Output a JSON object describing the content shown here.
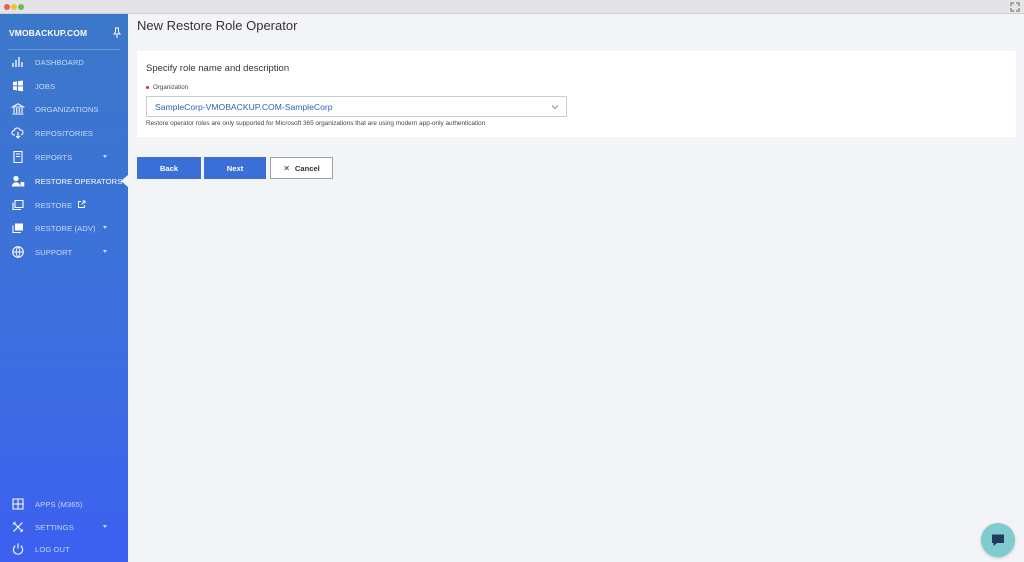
{
  "window": {
    "title": ""
  },
  "sidebar": {
    "brand": "VMOBACKUP.COM",
    "items": [
      {
        "label": "DASHBOARD",
        "icon": "dashboard-icon"
      },
      {
        "label": "JOBS",
        "icon": "windows-icon"
      },
      {
        "label": "ORGANIZATIONS",
        "icon": "bank-icon"
      },
      {
        "label": "REPOSITORIES",
        "icon": "cloud-download-icon"
      },
      {
        "label": "REPORTS",
        "icon": "report-icon",
        "has_caret": true
      },
      {
        "label": "RESTORE OPERATORS",
        "icon": "user-key-icon",
        "active": true
      },
      {
        "label": "RESTORE",
        "icon": "restore-icon",
        "external": true
      },
      {
        "label": "RESTORE (ADV)",
        "icon": "restore-adv-icon",
        "has_caret": true
      },
      {
        "label": "SUPPORT",
        "icon": "globe-icon",
        "has_caret": true
      }
    ],
    "bottom_items": [
      {
        "label": "APPS (M365)",
        "icon": "apps-grid-icon"
      },
      {
        "label": "SETTINGS",
        "icon": "tools-icon",
        "has_caret": true
      },
      {
        "label": "LOG OUT",
        "icon": "power-icon"
      }
    ]
  },
  "main": {
    "page_title": "New Restore Role Operator",
    "card": {
      "heading": "Specify role name and description",
      "org_label": "Organization",
      "org_value": "SampleCorp-VMOBACKUP.COM-SampleCorp",
      "help_text": "Restore operator roles are only supported for Microsoft 365 organizations that are using modern app-only authentication"
    },
    "buttons": {
      "back": "Back",
      "next": "Next",
      "cancel": "Cancel"
    }
  },
  "colors": {
    "sidebar_top": "#3c78c9",
    "sidebar_bottom": "#3c5ff0",
    "primary_button": "#3a6fd8",
    "select_text": "#2e62b8",
    "chat_bubble": "#7fcbd0"
  }
}
